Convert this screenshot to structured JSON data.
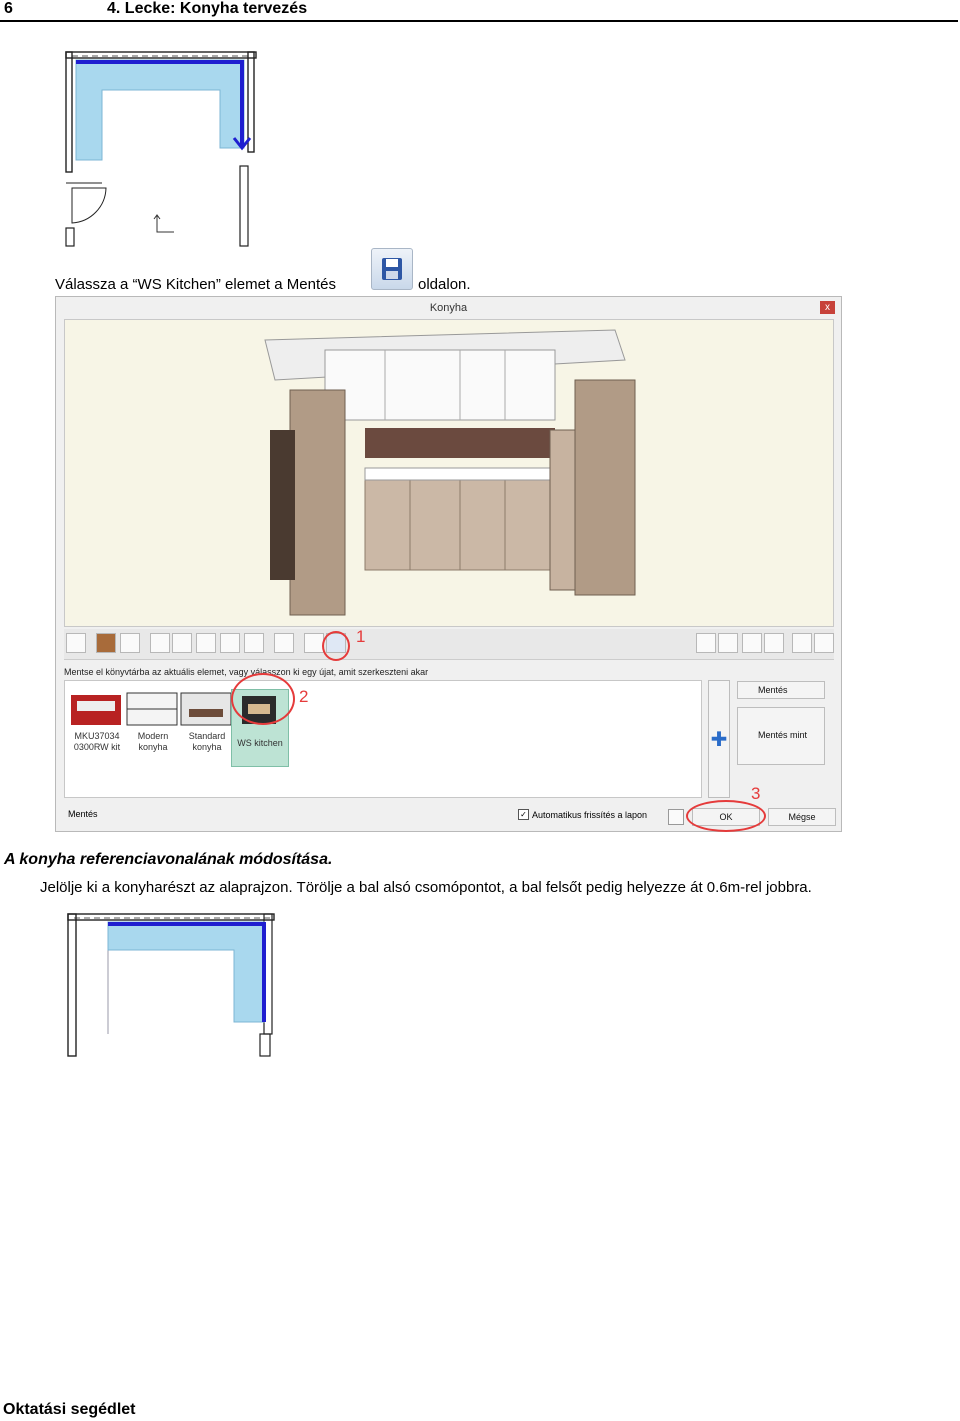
{
  "header": {
    "page_number": "6",
    "title": "4. Lecke: Konyha tervezés"
  },
  "intro": {
    "before": "Válassza a “WS Kitchen” elemet a Mentés",
    "after": "oldalon."
  },
  "dialog": {
    "title": "Konyha",
    "close": "x",
    "hint": "Mentse el könyvtárba az aktuális elemet, vagy válasszon ki egy újat, amit szerkeszteni akar",
    "library": [
      {
        "line1": "MKU37034",
        "line2": "0300RW kit"
      },
      {
        "line1": "Modern",
        "line2": "konyha"
      },
      {
        "line1": "Standard",
        "line2": "konyha"
      },
      {
        "line1": "WS kitchen",
        "line2": ""
      }
    ],
    "save_label": "Mentés",
    "save_as_label": "Mentés mint",
    "status_label": "Mentés",
    "auto_refresh_label": "Automatikus frissítés a lapon",
    "ok_label": "OK",
    "cancel_label": "Mégse",
    "annotations": [
      "1",
      "2",
      "3"
    ]
  },
  "section": {
    "title": "A konyha referenciavonalának módosítása.",
    "body": "Jelölje ki a konyharészt az alaprajzon. Törölje a bal alsó csomópontot, a bal felsőt pedig helyezze át 0.6m-rel jobbra."
  },
  "footer": {
    "text": "Oktatási segédlet"
  },
  "colors": {
    "highlight": "#a9d8ee",
    "refline": "#1f1fd0",
    "annotation": "#e53b3b"
  }
}
